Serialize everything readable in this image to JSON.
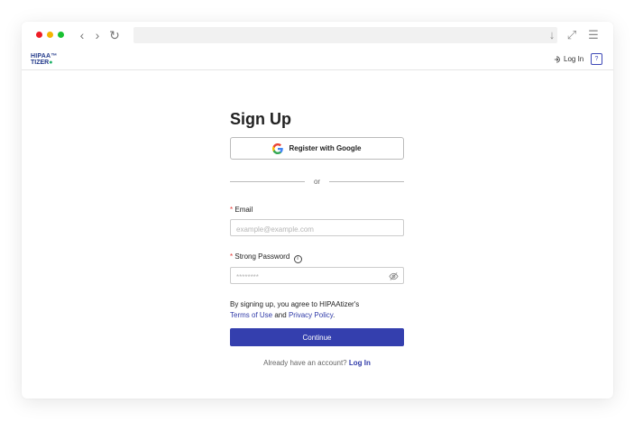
{
  "browser": {
    "nav": {
      "back_glyph": "‹",
      "forward_glyph": "›",
      "reload_glyph": "↻"
    },
    "controls": {
      "download_glyph": "↓",
      "expand_glyph": "⤢",
      "menu_glyph": "☰"
    },
    "dots": [
      "#ee1c25",
      "#f5b400",
      "#19c132"
    ]
  },
  "header": {
    "logo_line1": "HIPAA",
    "logo_line1_mark": "™",
    "logo_line2": "TIZER",
    "logo_line2_mark": "●",
    "login_label": "Log In",
    "help_glyph": "?"
  },
  "form": {
    "title": "Sign Up",
    "google_label": "Register with Google",
    "divider_text": "or",
    "email": {
      "required_mark": "*",
      "label": "Email",
      "placeholder": "example@example.com",
      "value": ""
    },
    "password": {
      "required_mark": "*",
      "label": "Strong Password",
      "info_glyph": "i",
      "placeholder": "********",
      "value": ""
    },
    "terms": {
      "prefix": "By signing up, you agree to HIPAAtizer's",
      "terms_link": "Terms of Use",
      "and": "and",
      "privacy_link": "Privacy Policy",
      "suffix": "."
    },
    "continue_label": "Continue",
    "footer": {
      "prompt": "Already have an account?",
      "login_link": "Log In"
    }
  },
  "colors": {
    "accent": "#343fae",
    "link": "#2f3aa8",
    "required": "#e53935",
    "brand": "#233a8b",
    "brand_green": "#22b36a"
  }
}
